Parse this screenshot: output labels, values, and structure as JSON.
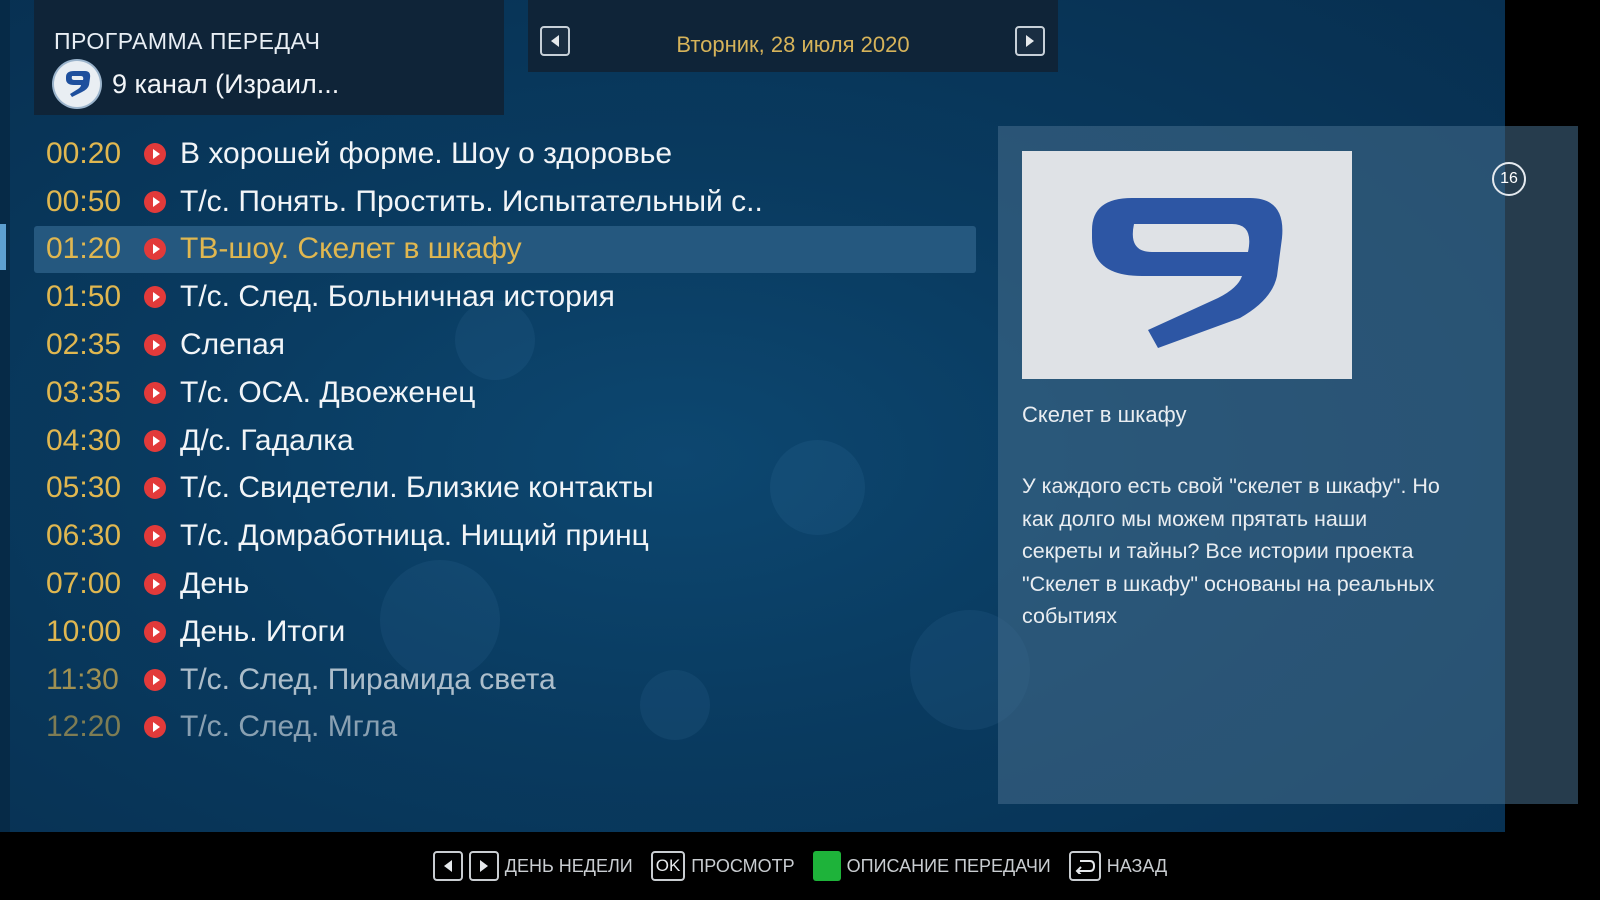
{
  "header": {
    "title": "ПРОГРАММА ПЕРЕДАЧ",
    "channel_logo_text": "9",
    "channel_name": "9 канал (Израил..."
  },
  "date_nav": {
    "date": "Вторник, 28 июля 2020",
    "prev_icon": "triangle-left-icon",
    "next_icon": "triangle-right-icon"
  },
  "programs": [
    {
      "time": "00:20",
      "title": "В хорошей форме. Шоу о здоровье"
    },
    {
      "time": "00:50",
      "title": "Т/с. Понять. Простить. Испытательный с.."
    },
    {
      "time": "01:20",
      "title": "ТВ-шоу. Скелет в шкафу",
      "selected": true
    },
    {
      "time": "01:50",
      "title": "Т/с. След. Больничная история"
    },
    {
      "time": "02:35",
      "title": "Слепая"
    },
    {
      "time": "03:35",
      "title": "Т/с. ОСА. Двоеженец"
    },
    {
      "time": "04:30",
      "title": "Д/с. Гадалка"
    },
    {
      "time": "05:30",
      "title": "Т/с. Свидетели. Близкие контакты"
    },
    {
      "time": "06:30",
      "title": "Т/с. Домработница. Нищий принц"
    },
    {
      "time": "07:00",
      "title": "День"
    },
    {
      "time": "10:00",
      "title": "День. Итоги"
    },
    {
      "time": "11:30",
      "title": "Т/с. След. Пирамида света"
    },
    {
      "time": "12:20",
      "title": "Т/с. След. Мгла"
    }
  ],
  "details": {
    "age_rating": "16",
    "title": "Скелет в шкафу",
    "description": "У каждого есть свой \"скелет в шкафу\". Но как долго мы можем прятать наши секреты и тайны? Все истории проекта \"Скелет в шкафу\" основаны на реальных событиях"
  },
  "footer": {
    "day_label": "ДЕНЬ НЕДЕЛИ",
    "ok_key": "OK",
    "view_label": "ПРОСМОТР",
    "desc_label": "ОПИСАНИЕ ПЕРЕДАЧИ",
    "back_label": "НАЗАД"
  },
  "colors": {
    "accent": "#e0b750",
    "selected_bg": "#25587f",
    "play_dot": "#e23a3a",
    "green_key": "#1eb33a"
  }
}
